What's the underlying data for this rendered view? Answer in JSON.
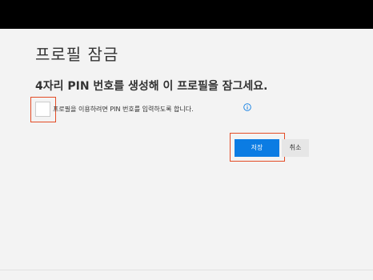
{
  "dialog": {
    "title": "프로필 잠금",
    "heading": "4자리 PIN 번호를 생성해 이 프로필을 잠그세요.",
    "checkbox_label": "프로필을 이용하려면 PIN 번호를 입력하도록 합니다.",
    "checkbox_checked": false,
    "save_label": "저장",
    "cancel_label": "취소"
  },
  "icons": {
    "info": "info-icon"
  },
  "colors": {
    "accent": "#0b7ce3",
    "highlight": "#e34c26",
    "background": "#f3f3f3",
    "topbar": "#000000"
  }
}
